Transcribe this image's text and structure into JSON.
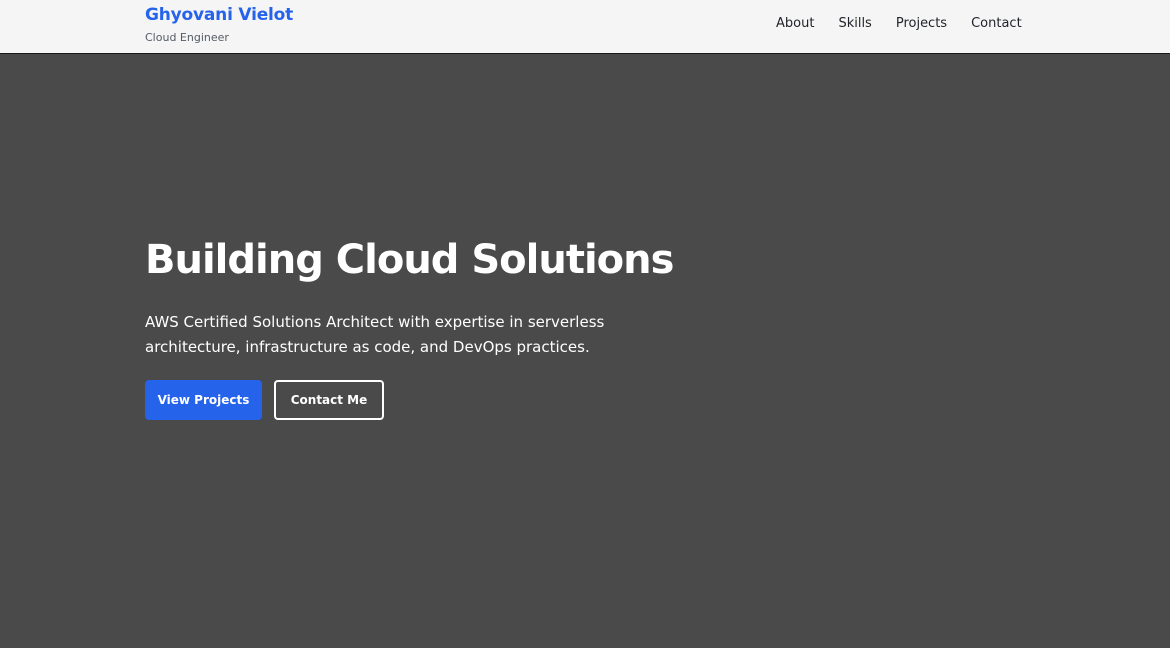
{
  "header": {
    "brand_name": "Ghyovani Vielot",
    "brand_tagline": "Cloud Engineer",
    "nav": [
      {
        "label": "About"
      },
      {
        "label": "Skills"
      },
      {
        "label": "Projects"
      },
      {
        "label": "Contact"
      }
    ]
  },
  "hero": {
    "title": "Building Cloud Solutions",
    "subtitle": "AWS Certified Solutions Architect with expertise in serverless architecture, infrastructure as code, and DevOps practices.",
    "primary_button": "View Projects",
    "secondary_button": "Contact Me"
  },
  "colors": {
    "accent": "#2563eb",
    "hero_background": "#4a4a4a",
    "navbar_background": "#f5f5f5"
  }
}
